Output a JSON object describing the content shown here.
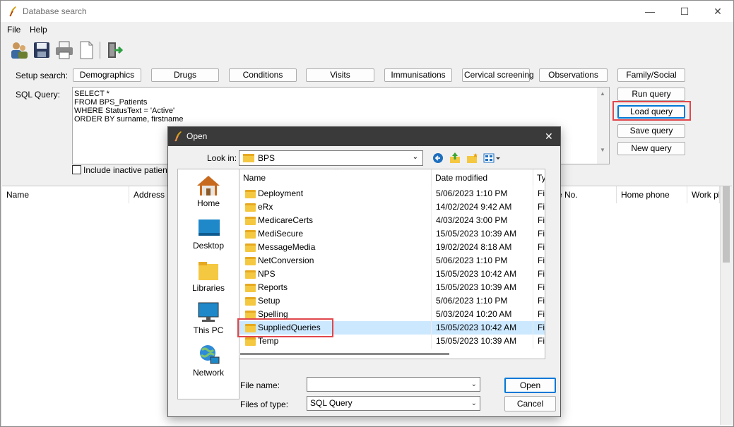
{
  "window": {
    "title": "Database search",
    "controls": {
      "minimize": "—",
      "maximize": "☐",
      "close": "✕"
    }
  },
  "menu": [
    "File",
    "Help"
  ],
  "toolbar": [
    "patients-icon",
    "save-icon",
    "printer-icon",
    "new-document-icon",
    "exit-icon"
  ],
  "setup": {
    "label": "Setup search:",
    "buttons": [
      "Demographics",
      "Drugs",
      "Conditions",
      "Visits",
      "Immunisations",
      "Cervical screening",
      "Observations",
      "Family/Social"
    ]
  },
  "sql": {
    "label": "SQL Query:",
    "lines": [
      "SELECT *",
      "FROM BPS_Patients",
      "WHERE StatusText = 'Active'",
      "ORDER BY surname, firstname"
    ]
  },
  "actions": {
    "run": "Run query",
    "load": "Load query",
    "save": "Save query",
    "new": "New query"
  },
  "include_inactive": {
    "label": "Include inactive patients",
    "checked": false
  },
  "grid": {
    "columns": [
      "Name",
      "Address",
      "e No.",
      "Home phone",
      "Work ph"
    ]
  },
  "dialog": {
    "title": "Open",
    "close": "✕",
    "lookin_label": "Look in:",
    "lookin_value": "BPS",
    "places": [
      "Home",
      "Desktop",
      "Libraries",
      "This PC",
      "Network"
    ],
    "columns": {
      "name": "Name",
      "date": "Date modified",
      "type": "Ty"
    },
    "files": [
      {
        "name": "Deployment",
        "date": "5/06/2023 1:10 PM",
        "type": "Fil"
      },
      {
        "name": "eRx",
        "date": "14/02/2024 9:42 AM",
        "type": "Fil"
      },
      {
        "name": "MedicareCerts",
        "date": "4/03/2024 3:00 PM",
        "type": "Fil"
      },
      {
        "name": "MediSecure",
        "date": "15/05/2023 10:39 AM",
        "type": "Fil"
      },
      {
        "name": "MessageMedia",
        "date": "19/02/2024 8:18 AM",
        "type": "Fil"
      },
      {
        "name": "NetConversion",
        "date": "5/06/2023 1:10 PM",
        "type": "Fil"
      },
      {
        "name": "NPS",
        "date": "15/05/2023 10:42 AM",
        "type": "Fil"
      },
      {
        "name": "Reports",
        "date": "15/05/2023 10:39 AM",
        "type": "Fil"
      },
      {
        "name": "Setup",
        "date": "5/06/2023 1:10 PM",
        "type": "Fil"
      },
      {
        "name": "Spelling",
        "date": "5/03/2024 10:20 AM",
        "type": "Fil"
      },
      {
        "name": "SuppliedQueries",
        "date": "15/05/2023 10:42 AM",
        "type": "Fil"
      },
      {
        "name": "Temp",
        "date": "15/05/2023 10:39 AM",
        "type": "Fil"
      }
    ],
    "selected_file": "SuppliedQueries",
    "filename_label": "File name:",
    "filename_value": "",
    "filetype_label": "Files of type:",
    "filetype_value": "SQL Query",
    "open_button": "Open",
    "cancel_button": "Cancel"
  },
  "colors": {
    "highlight_box": "#e0474c",
    "selection": "#cce8ff",
    "dialog_title_bg": "#3a3a3a",
    "accent": "#0078d7"
  }
}
